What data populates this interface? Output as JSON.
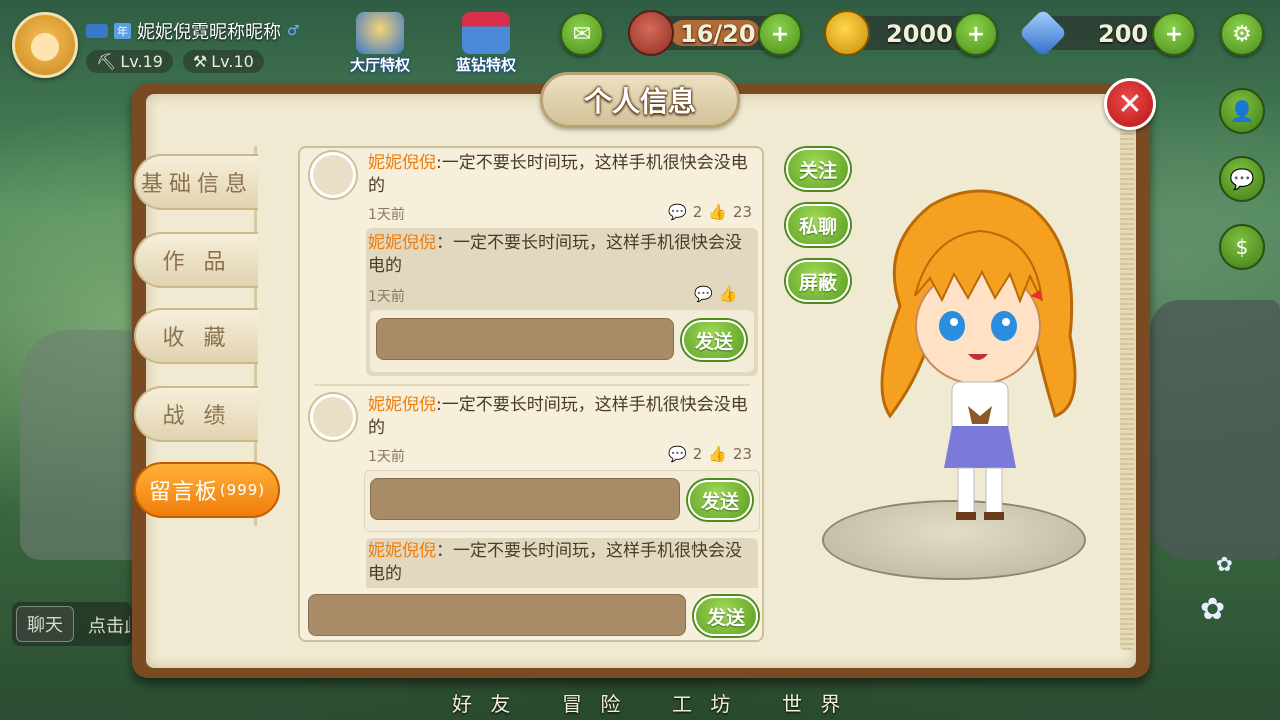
{
  "player": {
    "name": "妮妮倪霓昵称昵称",
    "year_tag": "年",
    "levels": [
      "Lv.19",
      "Lv.10"
    ]
  },
  "privileges": [
    "大厅特权",
    "蓝钻特权"
  ],
  "resources": {
    "stamina": "16/20",
    "coins": "2000",
    "diamonds": "200"
  },
  "panel": {
    "title": "个人信息",
    "tabs": [
      "基础信息",
      "作 品",
      "收 藏",
      "战 绩"
    ],
    "active_tab": {
      "label": "留言板",
      "count": "(999)"
    },
    "actions": [
      "关注",
      "私聊",
      "屏蔽"
    ]
  },
  "messages": [
    {
      "author": "妮妮倪倪",
      "text": ":一定不要长时间玩，这样手机很快会没电的",
      "time": "1天前",
      "comments": "2",
      "likes": "23",
      "reply": {
        "author": "妮妮倪倪",
        "text": "：一定不要长时间玩，这样手机很快会没电的",
        "time": "1天前"
      },
      "send_label": "发送"
    },
    {
      "author": "妮妮倪倪",
      "text": ":一定不要长时间玩，这样手机很快会没电的",
      "time": "1天前",
      "comments": "2",
      "likes": "23",
      "send_label": "发送",
      "reply": {
        "author": "妮妮倪倪",
        "text": "：一定不要长时间玩，这样手机很快会没电的"
      }
    }
  ],
  "bottom_send_label": "发送",
  "chat": {
    "button": "聊天",
    "hint": "点击此"
  },
  "nav": [
    "好 友",
    "冒 险",
    "工 坊",
    "世 界"
  ]
}
